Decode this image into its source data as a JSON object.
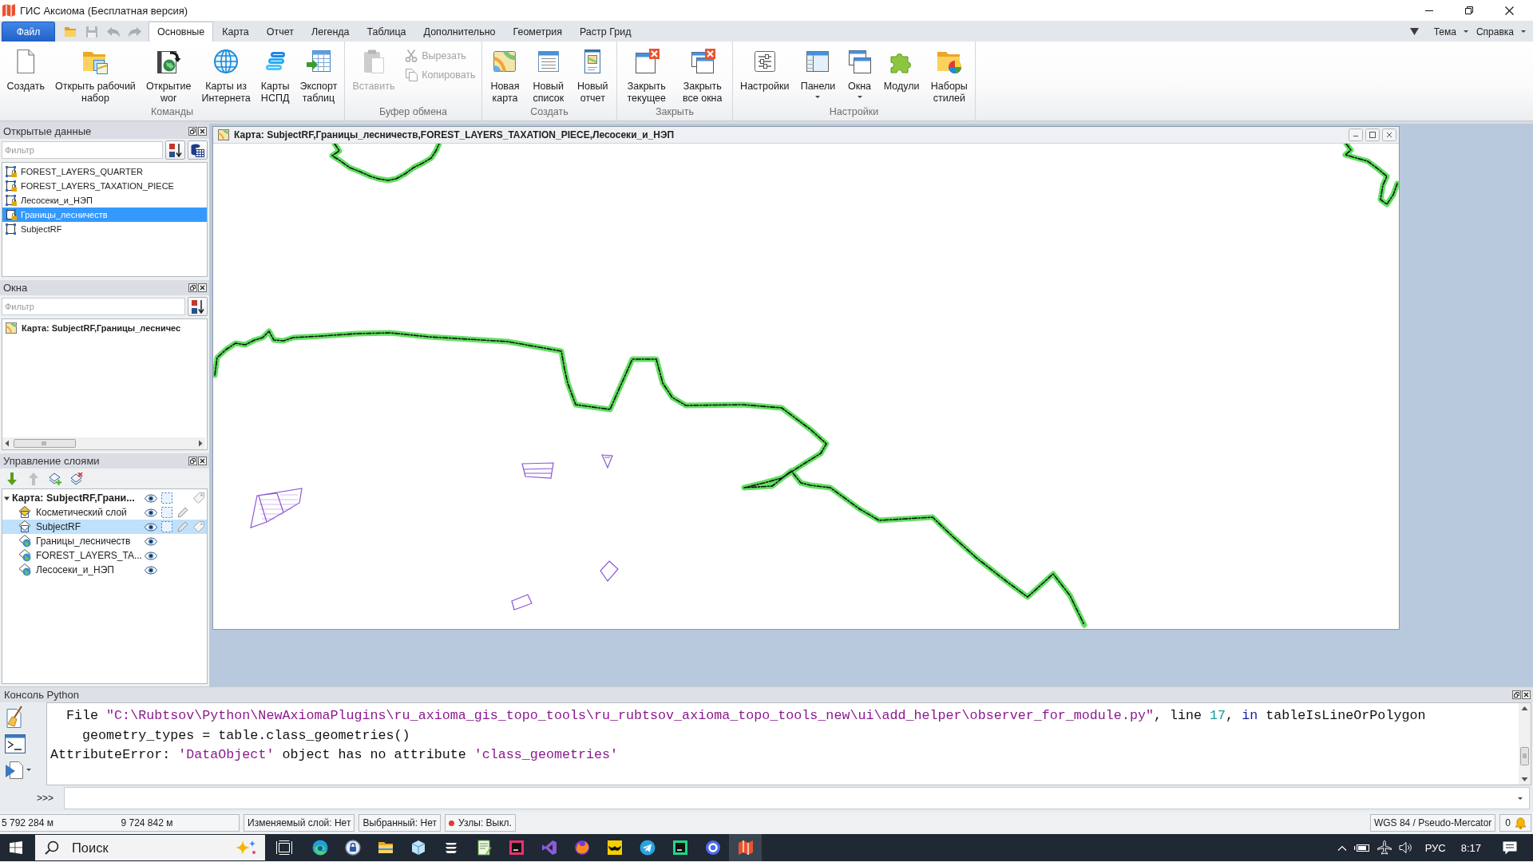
{
  "window": {
    "title": "ГИС Аксиома (Бесплатная версия)"
  },
  "file_tab": {
    "label": "Файл"
  },
  "quick_access": [
    {
      "disabled": false
    },
    {
      "disabled": true
    },
    {
      "disabled": true
    },
    {
      "disabled": true
    }
  ],
  "tabs": [
    {
      "label": "Основные",
      "selected": true
    },
    {
      "label": "Карта",
      "selected": false
    },
    {
      "label": "Отчет",
      "selected": false
    },
    {
      "label": "Легенда",
      "selected": false
    },
    {
      "label": "Таблица",
      "selected": false
    },
    {
      "label": "Дополнительно",
      "selected": false
    },
    {
      "label": "Геометрия",
      "selected": false
    },
    {
      "label": "Растр Грид",
      "selected": false
    }
  ],
  "top_menus": [
    {
      "label": "Тема"
    },
    {
      "label": "Справка"
    }
  ],
  "ribbon": [
    {
      "title": "Команды",
      "buttons": [
        {
          "kind": "large",
          "label": "Создать",
          "disabled": false,
          "dropdown": false
        },
        {
          "kind": "large",
          "label": "Открыть рабочий\nнабор",
          "disabled": false,
          "dropdown": false
        },
        {
          "kind": "large",
          "label": "Открытие\nwor",
          "disabled": false,
          "dropdown": false
        },
        {
          "kind": "large",
          "label": "Карты из\nИнтернета",
          "disabled": false,
          "dropdown": false
        },
        {
          "kind": "large",
          "label": "Карты\nНСПД",
          "disabled": false,
          "dropdown": false
        },
        {
          "kind": "large",
          "label": "Экспорт\nтаблиц",
          "disabled": false,
          "dropdown": false
        }
      ]
    },
    {
      "title": "Буфер обмена",
      "buttons": [
        {
          "kind": "large",
          "label": "Вставить",
          "disabled": true,
          "dropdown": false
        },
        {
          "kind": "small",
          "label": "Вырезать",
          "disabled": true,
          "dropdown": false
        },
        {
          "kind": "small",
          "label": "Копировать",
          "disabled": true,
          "dropdown": false
        }
      ]
    },
    {
      "title": "Создать",
      "buttons": [
        {
          "kind": "large",
          "label": "Новая\nкарта",
          "disabled": false,
          "dropdown": false
        },
        {
          "kind": "large",
          "label": "Новый\nсписок",
          "disabled": false,
          "dropdown": false
        },
        {
          "kind": "large",
          "label": "Новый\nотчет",
          "disabled": false,
          "dropdown": false
        }
      ]
    },
    {
      "title": "Закрыть",
      "buttons": [
        {
          "kind": "large",
          "label": "Закрыть\nтекущее",
          "disabled": false,
          "dropdown": false
        },
        {
          "kind": "large",
          "label": "Закрыть\nвсе окна",
          "disabled": false,
          "dropdown": false
        }
      ]
    },
    {
      "title": "Настройки",
      "buttons": [
        {
          "kind": "large",
          "label": "Настройки",
          "disabled": false,
          "dropdown": false
        },
        {
          "kind": "large",
          "label": "Панели",
          "disabled": false,
          "dropdown": true
        },
        {
          "kind": "large",
          "label": "Окна",
          "disabled": false,
          "dropdown": true
        },
        {
          "kind": "large",
          "label": "Модули",
          "disabled": false,
          "dropdown": false
        },
        {
          "kind": "large",
          "label": "Наборы\nстилей",
          "disabled": false,
          "dropdown": false
        }
      ]
    }
  ],
  "open_data": {
    "title": "Открытые данные",
    "filter": {
      "placeholder": "Фильтр"
    },
    "items": [
      {
        "label": "FOREST_LAYERS_QUARTER",
        "locked": true,
        "selected": false
      },
      {
        "label": "FOREST_LAYERS_TAXATION_PIECE",
        "locked": true,
        "selected": false
      },
      {
        "label": "Лесосеки_и_НЭП",
        "locked": true,
        "selected": false
      },
      {
        "label": "Границы_лесничеств",
        "locked": true,
        "selected": true
      },
      {
        "label": "SubjectRF",
        "locked": false,
        "selected": false
      }
    ]
  },
  "windows_panel": {
    "title": "Окна",
    "filter": {
      "placeholder": "Фильтр"
    },
    "items": [
      {
        "label": "Карта: SubjectRF,Границы_лесничес",
        "selected": false
      }
    ]
  },
  "layers": {
    "title": "Управление слоями",
    "toolbar": [
      {
        "disabled": false
      },
      {
        "disabled": true
      },
      {
        "disabled": false
      },
      {
        "disabled": false
      }
    ],
    "tree": [
      {
        "kind": "map",
        "label": "Карта: SubjectRF,Грани...",
        "expanded": true,
        "selected": false,
        "visible": true,
        "selectable": true,
        "editable": false,
        "labels": true,
        "children": [
          {
            "kind": "cosmetic",
            "label": "Косметический слой",
            "selected": false,
            "visible": true,
            "selectable": true,
            "editable": true,
            "labels": false
          },
          {
            "kind": "vector",
            "label": "SubjectRF",
            "selected": true,
            "visible": true,
            "selectable": true,
            "editable": true,
            "labels": true
          },
          {
            "kind": "remote",
            "label": "Границы_лесничеств",
            "selected": false,
            "visible": true,
            "selectable": false,
            "editable": false,
            "labels": false
          },
          {
            "kind": "remote",
            "label": "FOREST_LAYERS_TA...",
            "selected": false,
            "visible": true,
            "selectable": false,
            "editable": false,
            "labels": false
          },
          {
            "kind": "remote",
            "label": "Лесосеки_и_НЭП",
            "selected": false,
            "visible": true,
            "selectable": false,
            "editable": false,
            "labels": false
          }
        ]
      }
    ]
  },
  "map_window": {
    "title": "Карта: SubjectRF,Границы_лесничеств,FOREST_LAYERS_TAXATION_PIECE,Лесосеки_и_НЭП"
  },
  "console": {
    "title": "Консоль Python",
    "output": [
      {
        "kind": "frame",
        "parts": [
          {
            "kind": "plain",
            "text": "File "
          },
          {
            "kind": "string",
            "text": "\"C:\\Rubtsov\\Python\\NewAxiomaPlugins\\ru_axioma_gis_topo_tools\\ru_rubtsov_axioma_topo_tools_new\\ui\\add_helper\\observer_for_module.py\""
          },
          {
            "kind": "plain",
            "text": ", line "
          },
          {
            "kind": "number",
            "text": "17"
          },
          {
            "kind": "plain",
            "text": ", "
          },
          {
            "kind": "keyword",
            "text": "in"
          },
          {
            "kind": "plain",
            "text": " tableIsLineOrPolygon"
          }
        ]
      },
      {
        "kind": "source",
        "parts": [
          {
            "kind": "plain",
            "text": "geometry_types = table.class_geometries()"
          }
        ]
      },
      {
        "kind": "error",
        "parts": [
          {
            "kind": "plain",
            "text": "AttributeError: "
          },
          {
            "kind": "string",
            "text": "'DataObject'"
          },
          {
            "kind": "plain",
            "text": " object has no attribute "
          },
          {
            "kind": "string",
            "text": "'class_geometries'"
          }
        ]
      }
    ],
    "prompt": ">>>"
  },
  "status_bar": {
    "coordinates": [
      "5 792 284 м",
      "9 724 842 м"
    ],
    "fields": [
      "Изменяемый слой: Нет",
      "Выбранный: Нет"
    ],
    "nodes": {
      "label": "Узлы: Выкл.",
      "on": false
    },
    "projection": "WGS 84 / Pseudo-Mercator",
    "notifications": "0"
  },
  "taskbar": {
    "search": {
      "placeholder": "Поиск"
    },
    "apps": [
      {
        "active": false
      },
      {
        "active": false
      },
      {
        "active": false
      },
      {
        "active": false
      },
      {
        "active": false
      },
      {
        "active": false
      },
      {
        "active": false
      },
      {
        "active": false
      },
      {
        "active": false
      },
      {
        "active": false
      },
      {
        "active": false
      },
      {
        "active": false
      },
      {
        "active": false
      },
      {
        "active": true
      }
    ],
    "language": "РУС",
    "time": "8:17"
  }
}
